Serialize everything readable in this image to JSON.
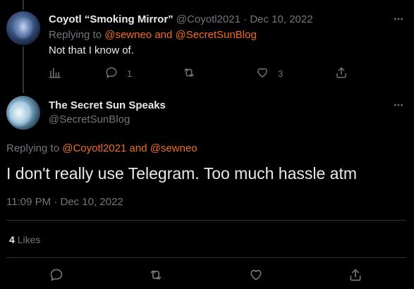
{
  "tweet1": {
    "display_name": "Coyotl “Smoking Mirror”",
    "handle": "@Coyotl2021",
    "separator": "·",
    "date": "Dec 10, 2022",
    "replying_prefix": "Replying to",
    "reply_user1": "@sewneo",
    "reply_and": "and",
    "reply_user2": "@SecretSunBlog",
    "text": "Not that I know of.",
    "reply_count": "1",
    "retweet_count": "",
    "like_count": "3"
  },
  "tweet2": {
    "display_name": "The Secret Sun Speaks",
    "handle": "@SecretSunBlog",
    "replying_prefix": "Replying to",
    "reply_user1": "@Coyotl2021",
    "reply_and": "and",
    "reply_user2": "@sewneo",
    "text": "I don't really use Telegram. Too much hassle atm",
    "time": "11:09 PM",
    "separator": "·",
    "date": "Dec 10, 2022",
    "likes_count": "4",
    "likes_label": "Likes"
  },
  "colors": {
    "background": "#000000",
    "text": "#e7e9ea",
    "muted": "#71767b",
    "link_accent": "#f26e1c",
    "divider": "#2f3336"
  },
  "icons": {
    "analytics": "bar-chart-icon",
    "reply": "speech-bubble-icon",
    "retweet": "retweet-icon",
    "like": "heart-icon",
    "share": "share-upload-icon",
    "more": "more-dots-icon"
  }
}
